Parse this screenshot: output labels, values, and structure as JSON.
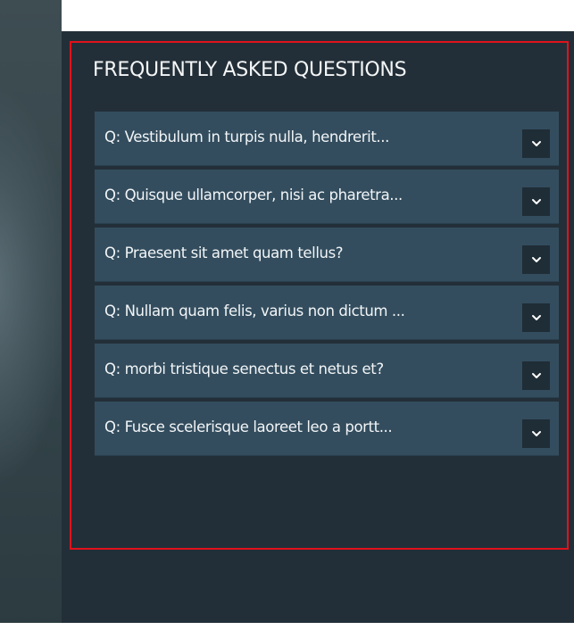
{
  "faq": {
    "title": "FREQUENTLY ASKED QUESTIONS",
    "items": [
      {
        "question": "Q: Vestibulum in turpis nulla, hendrerit...",
        "toggle_icon": "chevron-down-icon"
      },
      {
        "question": "Q: Quisque ullamcorper, nisi ac pharetra...",
        "toggle_icon": "chevron-down-icon"
      },
      {
        "question": "Q: Praesent sit amet quam tellus?",
        "toggle_icon": "chevron-down-icon"
      },
      {
        "question": "Q: Nullam quam felis, varius non dictum ...",
        "toggle_icon": "chevron-down-icon"
      },
      {
        "question": "Q: morbi tristique senectus et netus et?",
        "toggle_icon": "chevron-down-icon"
      },
      {
        "question": "Q: Fusce scelerisque laoreet leo a portt...",
        "toggle_icon": "chevron-down-icon"
      }
    ]
  },
  "colors": {
    "section_background": "#232f38",
    "item_background": "#334d5e",
    "toggle_background": "#1f2d36",
    "highlight_border": "#e0121b",
    "text": "#f2f5f7"
  }
}
